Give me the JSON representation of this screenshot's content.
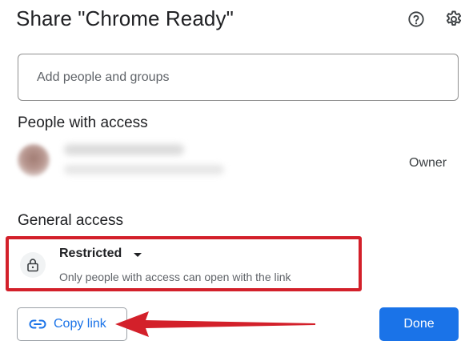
{
  "dialog": {
    "title": "Share \"Chrome Ready\"",
    "header_icons": [
      "help-icon",
      "settings-icon"
    ]
  },
  "add_people": {
    "placeholder": "Add people and groups"
  },
  "people_with_access": {
    "heading": "People with access",
    "people": [
      {
        "name": "",
        "email": "",
        "role": "Owner",
        "avatar": "blurred"
      }
    ]
  },
  "general_access": {
    "heading": "General access",
    "icon": "lock-icon",
    "level": "Restricted",
    "description": "Only people with access can open with the link"
  },
  "footer": {
    "copy_link_label": "Copy link",
    "copy_link_icon": "link-icon",
    "done_label": "Done"
  },
  "colors": {
    "primary": "#1a73e8",
    "annotation_red": "#d3202a",
    "text": "#202124",
    "muted": "#5f6368"
  }
}
